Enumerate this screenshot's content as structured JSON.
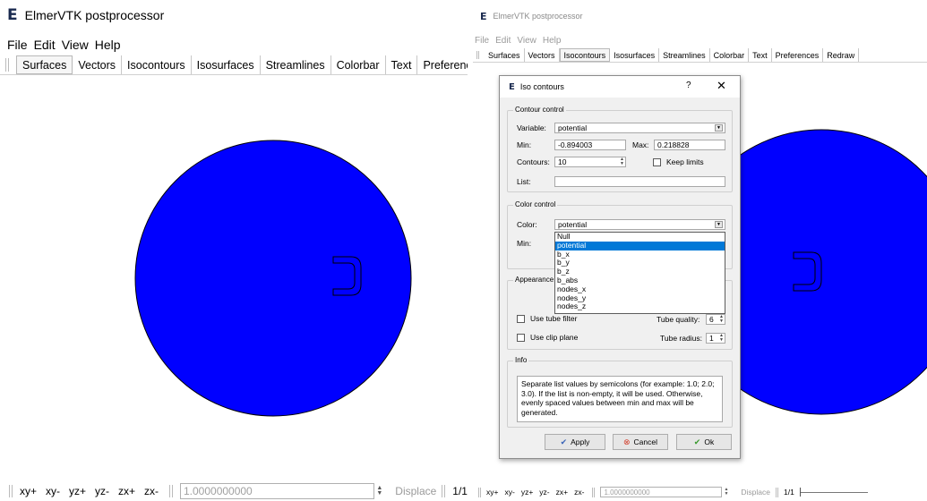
{
  "app": {
    "title": "ElmerVTK postprocessor",
    "logo_letter": "E",
    "menu": [
      "File",
      "Edit",
      "View",
      "Help"
    ],
    "tabs_left": [
      "Surfaces",
      "Vectors",
      "Isocontours",
      "Isosurfaces",
      "Streamlines",
      "Colorbar",
      "Text",
      "Preferences"
    ],
    "tabs_right": [
      "Surfaces",
      "Vectors",
      "Isocontours",
      "Isosurfaces",
      "Streamlines",
      "Colorbar",
      "Text",
      "Preferences",
      "Redraw"
    ],
    "active_left_tab": "Surfaces",
    "active_right_tab": "Isocontours"
  },
  "bottombar": {
    "view_buttons": [
      "xy+",
      "xy-",
      "yz+",
      "yz-",
      "zx+",
      "zx-"
    ],
    "scale_value": "1.0000000000",
    "displace_label": "Displace",
    "frame_label": "1/1"
  },
  "colors": {
    "mesh_fill": "#0000ff",
    "mesh_stroke": "#000000",
    "selection": "#0078d7"
  },
  "dialog": {
    "title": "Iso contours",
    "help_label": "?",
    "close_label": "✕",
    "contour_control": {
      "title": "Contour control",
      "variable_label": "Variable:",
      "variable_value": "potential",
      "min_label": "Min:",
      "min_value": "-0.894003",
      "max_label": "Max:",
      "max_value": "0.218828",
      "contours_label": "Contours:",
      "contours_value": "10",
      "keep_limits_label": "Keep limits",
      "list_label": "List:",
      "list_value": ""
    },
    "color_control": {
      "title": "Color control",
      "color_label": "Color:",
      "color_value": "potential",
      "min_label": "Min:",
      "options": [
        "Null",
        "potential",
        "b_x",
        "b_y",
        "b_z",
        "b_abs",
        "nodes_x",
        "nodes_y",
        "nodes_z"
      ],
      "selected_index": 1
    },
    "appearance": {
      "title": "Appearance",
      "use_tube_filter_label": "Use tube filter",
      "tube_quality_label": "Tube quality:",
      "tube_quality_value": "6",
      "use_clip_plane_label": "Use clip plane",
      "tube_radius_label": "Tube radius:",
      "tube_radius_value": "1"
    },
    "info": {
      "title": "Info",
      "text": "Separate list values by semicolons (for example: 1.0; 2.0; 3.0). If the list is non-empty, it will be used. Otherwise, evenly spaced values between min and max will be generated."
    },
    "buttons": {
      "apply": "Apply",
      "cancel": "Cancel",
      "ok": "Ok"
    }
  }
}
